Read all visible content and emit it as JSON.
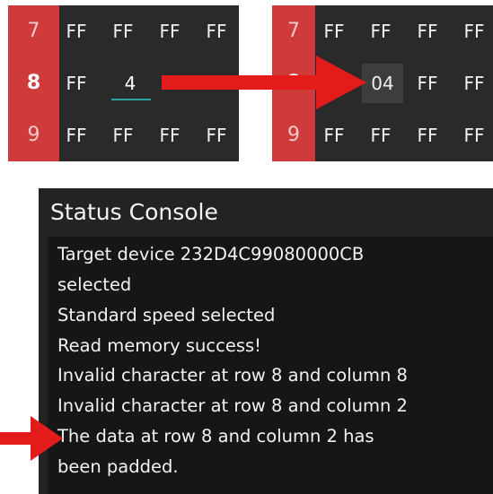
{
  "grid_before": {
    "rows": [
      {
        "label": "7",
        "cells": [
          "FF",
          "FF",
          "FF",
          "FF"
        ]
      },
      {
        "label": "8",
        "cells": [
          "FF",
          "4",
          "",
          ""
        ]
      },
      {
        "label": "9",
        "cells": [
          "FF",
          "FF",
          "FF",
          "FF"
        ]
      }
    ]
  },
  "grid_after": {
    "rows": [
      {
        "label": "7",
        "cells": [
          "FF",
          "FF",
          "FF",
          "FF"
        ]
      },
      {
        "label": "8",
        "cells": [
          "04",
          "FF",
          "FF"
        ]
      },
      {
        "label": "9",
        "cells": [
          "FF",
          "FF",
          "FF",
          "FF"
        ]
      }
    ]
  },
  "console": {
    "title": "Status Console",
    "lines": [
      "Target device 232D4C99080000CB",
      "selected",
      "Standard speed selected",
      "Read memory success!",
      "Invalid character at row 8 and column 8",
      "Invalid character at row 8 and column 2",
      "The data at row 8 and column 2 has",
      "been padded."
    ]
  },
  "colors": {
    "row_header": "#cf3a3a",
    "grid_bg": "#2a2a2a",
    "arrow": "#e41b1b",
    "edit_underline": "#2aa3a0"
  }
}
